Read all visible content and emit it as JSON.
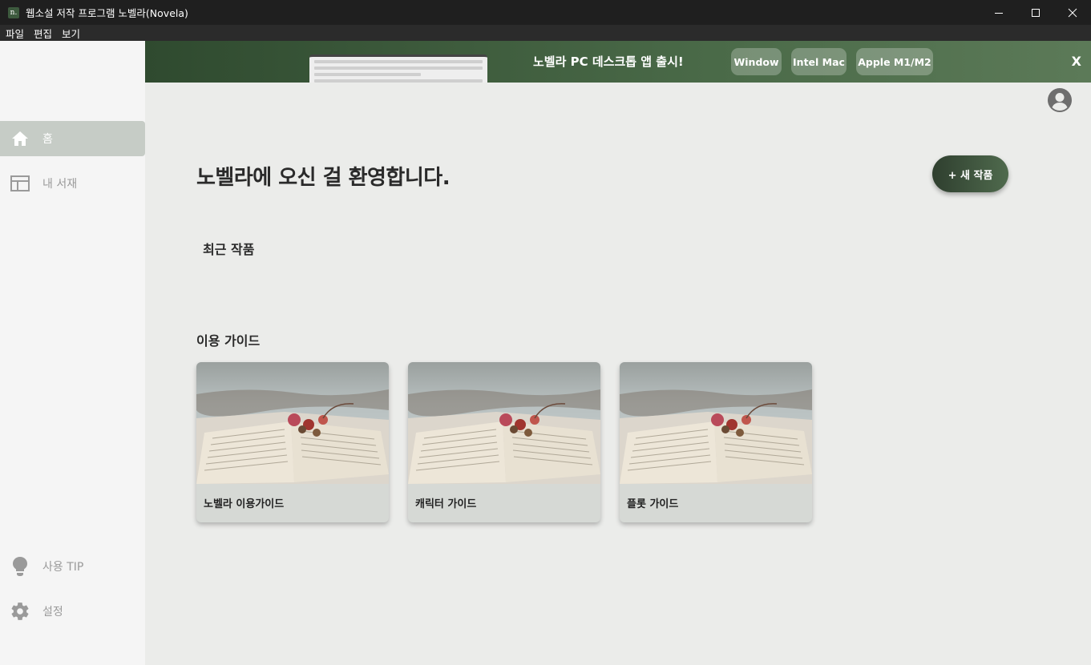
{
  "window": {
    "title": "웹소설 저작 프로그램 노벨라(Novela)",
    "logo_text": "n."
  },
  "menu": [
    "파일",
    "편집",
    "보기"
  ],
  "sidebar": {
    "items": [
      {
        "label": "홈",
        "icon": "home-icon",
        "active": true
      },
      {
        "label": "내 서재",
        "icon": "library-icon",
        "active": false
      }
    ],
    "bottom_items": [
      {
        "label": "사용 TIP",
        "icon": "lightbulb-icon"
      },
      {
        "label": "설정",
        "icon": "gear-icon"
      }
    ]
  },
  "banner": {
    "text": "노벨라 PC 데스크톱 앱 출시!",
    "buttons": [
      "Window",
      "Intel Mac",
      "Apple M1/M2"
    ],
    "close": "X"
  },
  "main": {
    "welcome": "노벨라에 오신 걸 환영합니다.",
    "new_work_button": "+ 새 작품",
    "recent_title": "최근 작품",
    "guide_title": "이용 가이드",
    "guides": [
      {
        "label": "노벨라 이용가이드"
      },
      {
        "label": "캐릭터 가이드"
      },
      {
        "label": "플롯 가이드"
      }
    ]
  },
  "colors": {
    "accent": "#3d5a3e",
    "sidebar_active": "#c6ccc6",
    "main_bg": "#ebecea"
  }
}
